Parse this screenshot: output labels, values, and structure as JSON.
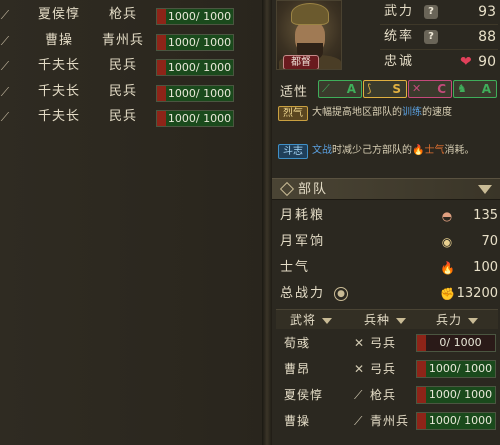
{
  "left_troops": [
    {
      "name": "夏侯惇",
      "type": "枪兵",
      "strength": "1000/ 1000",
      "fill": 1.0,
      "icon": "spear-icon"
    },
    {
      "name": "曹操",
      "type": "青州兵",
      "strength": "1000/ 1000",
      "fill": 1.0,
      "icon": "sword-icon"
    },
    {
      "name": "千夫长",
      "type": "民兵",
      "strength": "1000/ 1000",
      "fill": 1.0,
      "icon": "sword-icon"
    },
    {
      "name": "千夫长",
      "type": "民兵",
      "strength": "1000/ 1000",
      "fill": 1.0,
      "icon": "sword-icon"
    },
    {
      "name": "千夫长",
      "type": "民兵",
      "strength": "1000/ 1000",
      "fill": 1.0,
      "icon": "sword-icon"
    }
  ],
  "general": {
    "rank": "都督",
    "stats": [
      {
        "label": "武力",
        "value": "93",
        "icon": "question-icon"
      },
      {
        "label": "统率",
        "value": "88",
        "icon": "question-icon"
      },
      {
        "label": "忠诚",
        "value": "90",
        "icon": "heart-icon"
      }
    ]
  },
  "aptitude": {
    "label": "适性",
    "chips": [
      {
        "icon": "spear-icon",
        "grade": "A",
        "color": "#3fae5a"
      },
      {
        "icon": "bow-icon",
        "grade": "S",
        "color": "#e0b040"
      },
      {
        "icon": "crossed-swords-icon",
        "grade": "C",
        "color": "#c44a7a"
      },
      {
        "icon": "horse-icon",
        "grade": "A",
        "color": "#3fae5a"
      }
    ]
  },
  "skills": [
    {
      "tag": "烈气",
      "tag_color": "#c9a040",
      "text_before": "大幅提高地区部队的",
      "highlight": "训练",
      "text_after": "的速度"
    },
    {
      "tag": "斗志",
      "tag_color": "#3f90c8",
      "text_before": "文战",
      "highlight": "",
      "text_after": "时减少己方部队的",
      "fire": "🔥",
      "highlight2": "士气",
      "text_end": "消耗。"
    }
  ],
  "section": {
    "title": "部队"
  },
  "army_stats": [
    {
      "label": "月耗粮",
      "value": "135",
      "icon": "rice-bowl-icon",
      "glyph": "◓",
      "color": "#e0a080"
    },
    {
      "label": "月军饷",
      "value": "70",
      "icon": "coin-icon",
      "glyph": "◉",
      "color": "#e8d090"
    },
    {
      "label": "士气",
      "value": "100",
      "icon": "flame-icon",
      "glyph": "🔥",
      "color": "#e07030"
    },
    {
      "label": "总战力",
      "value": "13200",
      "icon": "fist-icon",
      "glyph": "✊",
      "color": "#e0b888",
      "eye": "eye-icon"
    }
  ],
  "roster_header": {
    "col1": "武将",
    "col2": "兵种",
    "col3": "兵力"
  },
  "roster": [
    {
      "name": "荀彧",
      "type": "弓兵",
      "icon": "bow-icon",
      "glyph": "✕",
      "strength": "0/ 1000",
      "fill": 0.0
    },
    {
      "name": "曹昂",
      "type": "弓兵",
      "icon": "bow-icon",
      "glyph": "✕",
      "strength": "1000/ 1000",
      "fill": 1.0
    },
    {
      "name": "夏侯惇",
      "type": "枪兵",
      "icon": "spear-icon",
      "glyph": "⟋",
      "strength": "1000/ 1000",
      "fill": 1.0
    },
    {
      "name": "曹操",
      "type": "青州兵",
      "icon": "sword-icon",
      "glyph": "⟋",
      "strength": "1000/ 1000",
      "fill": 1.0
    }
  ]
}
